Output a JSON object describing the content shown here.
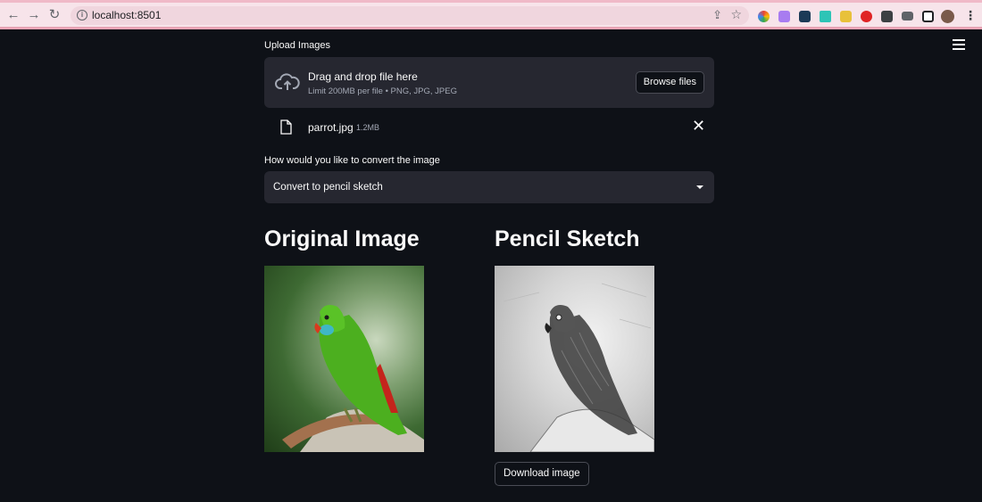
{
  "browser": {
    "url": "localhost:8501"
  },
  "uploader": {
    "label": "Upload Images",
    "drop_title": "Drag and drop file here",
    "drop_subtitle": "Limit 200MB per file • PNG, JPG, JPEG",
    "browse_label": "Browse files"
  },
  "file": {
    "name": "parrot.jpg",
    "size": "1.2MB"
  },
  "convert": {
    "label": "How would you like to convert the image",
    "selected": "Convert to pencil sketch"
  },
  "original": {
    "heading": "Original Image"
  },
  "sketch": {
    "heading": "Pencil Sketch",
    "download_label": "Download image"
  },
  "colors": {
    "background": "#0e1117",
    "widget": "#262730",
    "text": "#fafafa",
    "parrot_green": "#4caf1f"
  },
  "icons": [
    "back-icon",
    "forward-icon",
    "reload-icon",
    "info-icon",
    "share-icon",
    "star-icon",
    "menu-icon",
    "cloud-upload-icon",
    "file-icon",
    "close-icon",
    "chevron-down-icon"
  ]
}
